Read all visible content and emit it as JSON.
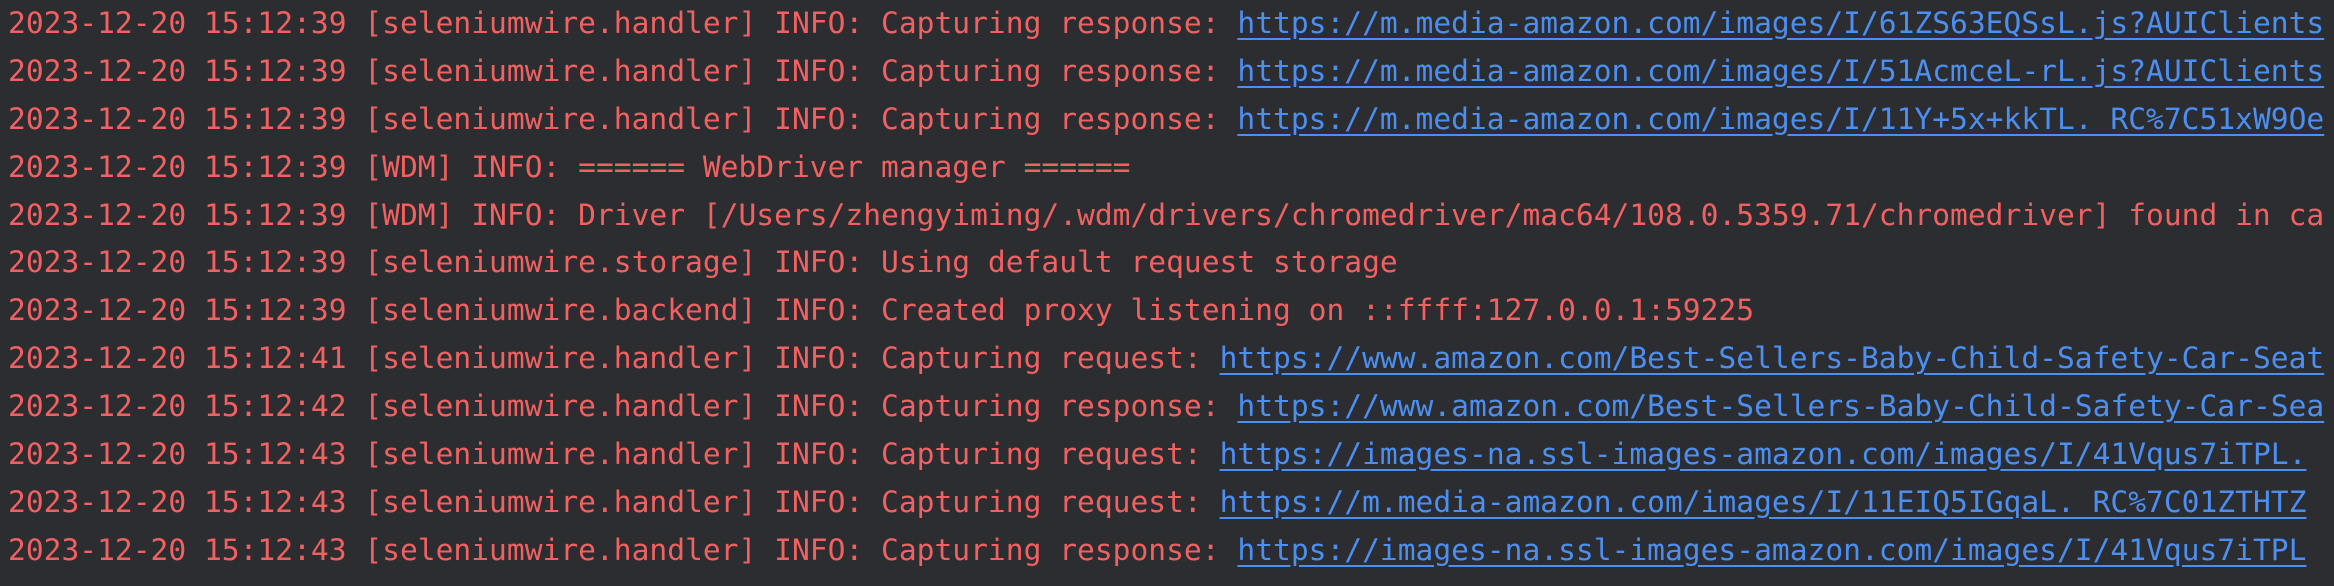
{
  "console": {
    "lines": [
      {
        "text": "2023-12-20 15:12:39 [seleniumwire.handler] INFO: Capturing response: ",
        "link": "https://m.media-amazon.com/images/I/61ZS63EQSsL.js?AUIClients"
      },
      {
        "text": "2023-12-20 15:12:39 [seleniumwire.handler] INFO: Capturing response: ",
        "link": "https://m.media-amazon.com/images/I/51AcmceL-rL.js?AUIClients"
      },
      {
        "text": "2023-12-20 15:12:39 [seleniumwire.handler] INFO: Capturing response: ",
        "link": "https://m.media-amazon.com/images/I/11Y+5x+kkTL._RC%7C51xW9Oe"
      },
      {
        "text": "2023-12-20 15:12:39 [WDM] INFO: ====== WebDriver manager ======",
        "link": ""
      },
      {
        "text": "2023-12-20 15:12:39 [WDM] INFO: Driver [/Users/zhengyiming/.wdm/drivers/chromedriver/mac64/108.0.5359.71/chromedriver] found in ca",
        "link": ""
      },
      {
        "text": "2023-12-20 15:12:39 [seleniumwire.storage] INFO: Using default request storage",
        "link": ""
      },
      {
        "text": "2023-12-20 15:12:39 [seleniumwire.backend] INFO: Created proxy listening on ::ffff:127.0.0.1:59225",
        "link": ""
      },
      {
        "text": "2023-12-20 15:12:41 [seleniumwire.handler] INFO: Capturing request: ",
        "link": "https://www.amazon.com/Best-Sellers-Baby-Child-Safety-Car-Seat"
      },
      {
        "text": "2023-12-20 15:12:42 [seleniumwire.handler] INFO: Capturing response: ",
        "link": "https://www.amazon.com/Best-Sellers-Baby-Child-Safety-Car-Sea"
      },
      {
        "text": "2023-12-20 15:12:43 [seleniumwire.handler] INFO: Capturing request: ",
        "link": "https://images-na.ssl-images-amazon.com/images/I/41Vqus7iTPL."
      },
      {
        "text": "2023-12-20 15:12:43 [seleniumwire.handler] INFO: Capturing request: ",
        "link": "https://m.media-amazon.com/images/I/11EIQ5IGqaL._RC%7C01ZTHTZ"
      },
      {
        "text": "2023-12-20 15:12:43 [seleniumwire.handler] INFO: Capturing response: ",
        "link": "https://images-na.ssl-images-amazon.com/images/I/41Vqus7iTPL"
      }
    ]
  },
  "colors": {
    "background": "#2b2d30",
    "log_text": "#f26161",
    "link": "#4d8ff0"
  }
}
